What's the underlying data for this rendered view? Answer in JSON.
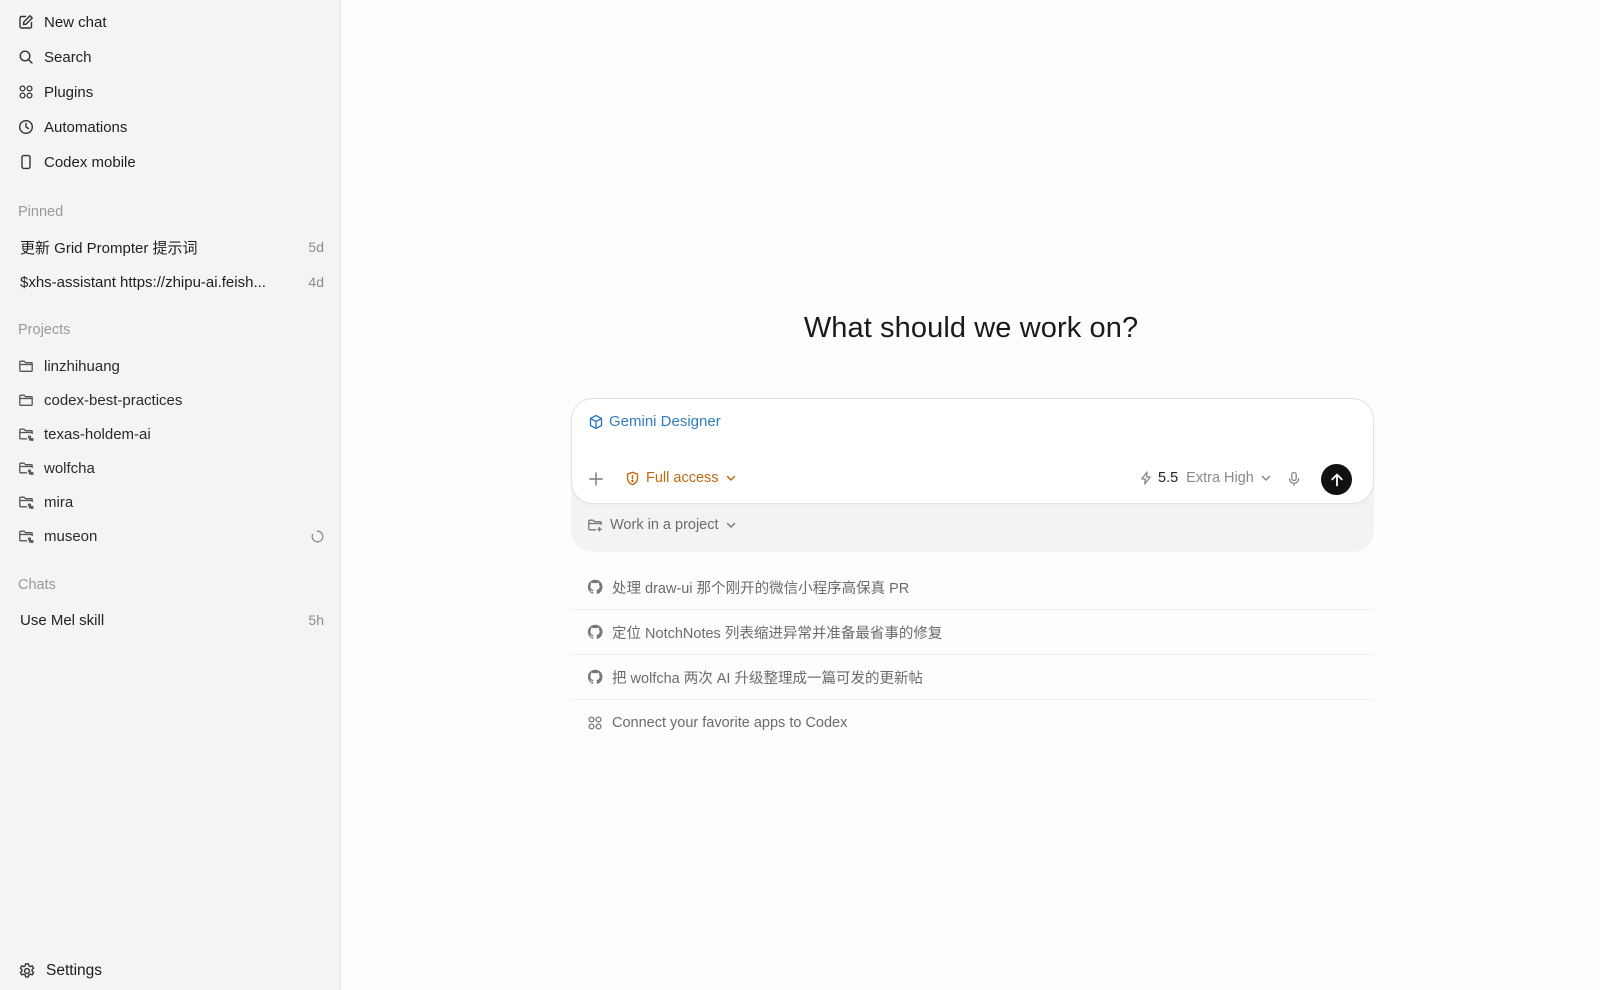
{
  "sidebar": {
    "nav": [
      {
        "label": "New chat",
        "icon": "compose-icon"
      },
      {
        "label": "Search",
        "icon": "search-icon"
      },
      {
        "label": "Plugins",
        "icon": "grid-icon"
      },
      {
        "label": "Automations",
        "icon": "clock-icon"
      },
      {
        "label": "Codex mobile",
        "icon": "phone-icon"
      }
    ],
    "pinned_label": "Pinned",
    "pinned": [
      {
        "title": "更新 Grid Prompter 提示词",
        "age": "5d"
      },
      {
        "title": "$xhs-assistant https://zhipu-ai.feish...",
        "age": "4d"
      }
    ],
    "projects_label": "Projects",
    "projects": [
      {
        "label": "linzhihuang",
        "icon": "folder-icon"
      },
      {
        "label": "codex-best-practices",
        "icon": "folder-icon"
      },
      {
        "label": "texas-holdem-ai",
        "icon": "folder-branch-icon"
      },
      {
        "label": "wolfcha",
        "icon": "folder-branch-icon"
      },
      {
        "label": "mira",
        "icon": "folder-branch-icon"
      },
      {
        "label": "museon",
        "icon": "folder-branch-icon",
        "loading": true
      }
    ],
    "chats_label": "Chats",
    "chats": [
      {
        "title": "Use Mel skill",
        "age": "5h"
      }
    ],
    "settings_label": "Settings"
  },
  "main": {
    "headline": "What should we work on?",
    "composer": {
      "skill_tag": "Gemini Designer",
      "access_label": "Full access",
      "model_version": "5.5",
      "model_effort": "Extra High",
      "project_label": "Work in a project"
    },
    "suggestions": [
      {
        "text": "处理 draw-ui 那个刚开的微信小程序高保真 PR",
        "icon": "github-icon"
      },
      {
        "text": "定位 NotchNotes 列表缩进异常并准备最省事的修复",
        "icon": "github-icon"
      },
      {
        "text": "把 wolfcha 两次 AI 升级整理成一篇可发的更新帖",
        "icon": "github-icon"
      },
      {
        "text": "Connect your favorite apps to Codex",
        "icon": "grid-icon"
      }
    ]
  },
  "colors": {
    "accent_blue": "#2f7dbd",
    "access_orange": "#c26a12",
    "sidebar_bg": "#f4f4f4",
    "send_button": "#111111"
  }
}
